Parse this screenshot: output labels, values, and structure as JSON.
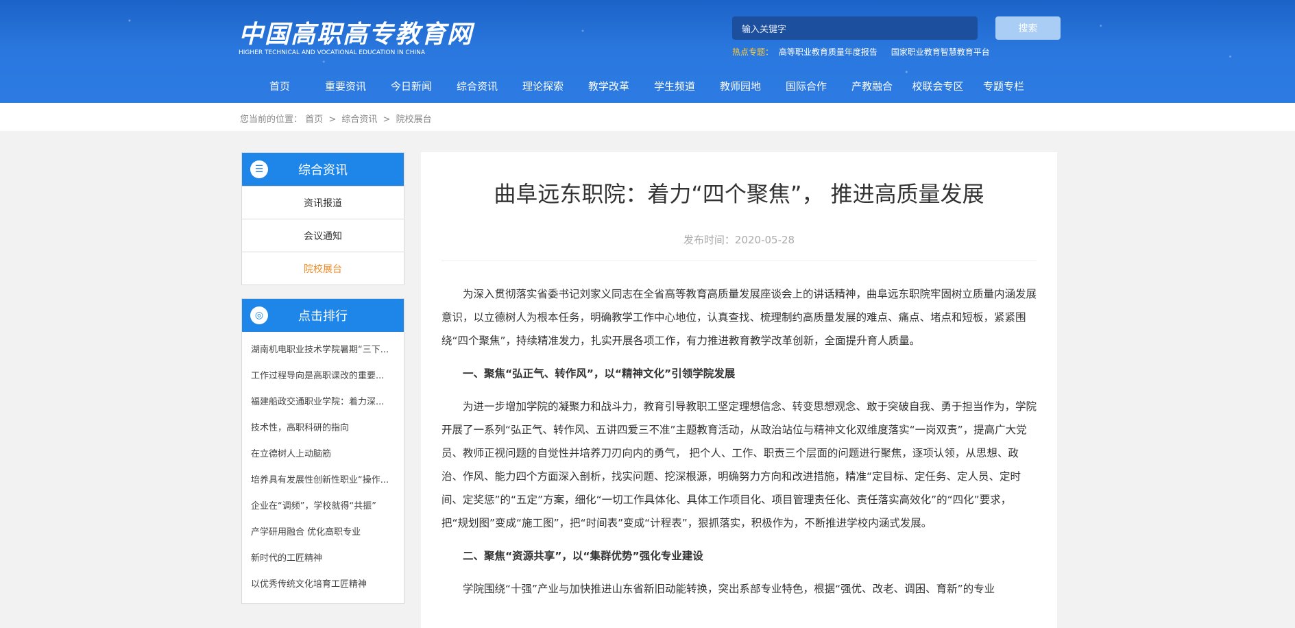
{
  "header": {
    "logo_cn": "中国高职高专教育网",
    "logo_en": "HIGHER TECHNICAL AND VOCATIONAL EDUCATION IN CHINA",
    "search_placeholder": "输入关键字",
    "search_button": "搜索",
    "hot_label": "热点专题：",
    "hot_links": [
      "高等职业教育质量年度报告",
      "国家职业教育智慧教育平台"
    ],
    "nav": [
      "首页",
      "重要资讯",
      "今日新闻",
      "综合资讯",
      "理论探索",
      "教学改革",
      "学生频道",
      "教师园地",
      "国际合作",
      "产教融合",
      "校联会专区",
      "专题专栏"
    ]
  },
  "breadcrumb": {
    "prefix": "您当前的位置：",
    "items": [
      "首页",
      "综合资讯",
      "院校展台"
    ],
    "separator": ">"
  },
  "sidebar": {
    "category": {
      "title": "综合资讯",
      "icon": "list-icon",
      "items": [
        {
          "label": "资讯报道",
          "active": false
        },
        {
          "label": "会议通知",
          "active": false
        },
        {
          "label": "院校展台",
          "active": true
        }
      ]
    },
    "ranking": {
      "title": "点击排行",
      "icon": "target-icon",
      "items": [
        "湖南机电职业技术学院暑期“三下...",
        "工作过程导向是高职课改的重要...",
        "福建船政交通职业学院：着力深...",
        "技术性，高职科研的指向",
        "在立德树人上动脑筋",
        "培养具有发展性创新性职业“操作...",
        "企业在“调频”，学校就得“共振”",
        "产学研用融合 优化高职专业",
        "新时代的工匠精神",
        "以优秀传统文化培育工匠精神"
      ]
    }
  },
  "article": {
    "title": "曲阜远东职院：着力“四个聚焦”， 推进高质量发展",
    "date_label": "发布时间：",
    "date": "2020-05-28",
    "paragraphs": [
      {
        "heading": false,
        "text": "为深入贯彻落实省委书记刘家义同志在全省高等教育高质量发展座谈会上的讲话精神，曲阜远东职院牢固树立质量内涵发展意识，以立德树人为根本任务，明确教学工作中心地位，认真查找、梳理制约高质量发展的难点、痛点、堵点和短板，紧紧围绕“四个聚焦”，持续精准发力，扎实开展各项工作，有力推进教育教学改革创新，全面提升育人质量。"
      },
      {
        "heading": true,
        "text": "一、聚焦“弘正气、转作风”，以“精神文化”引领学院发展"
      },
      {
        "heading": false,
        "text": "为进一步增加学院的凝聚力和战斗力，教育引导教职工坚定理想信念、转变思想观念、敢于突破自我、勇于担当作为，学院开展了一系列“弘正气、转作风、五讲四爱三不准”主题教育活动，从政治站位与精神文化双维度落实“一岗双责”，提高广大党员、教师正视问题的自觉性并培养刀刃向内的勇气， 把个人、工作、职责三个层面的问题进行聚焦，逐项认领，从思想、政治、作风、能力四个方面深入剖析，找实问题、挖深根源，明确努力方向和改进措施，精准“定目标、定任务、定人员、定时间、定奖惩”的“五定”方案，细化“一切工作具体化、具体工作项目化、项目管理责任化、责任落实高效化”的“四化”要求，把“规划图”变成“施工图”，把“时间表”变成“计程表”，狠抓落实，积极作为，不断推进学校内涵式发展。"
      },
      {
        "heading": true,
        "text": "二、聚焦“资源共享”，以“集群优势”强化专业建设"
      },
      {
        "heading": false,
        "text": "学院围绕“十强”产业与加快推进山东省新旧动能转换，突出系部专业特色，根据“强优、改老、调困、育新”的专业"
      }
    ]
  }
}
